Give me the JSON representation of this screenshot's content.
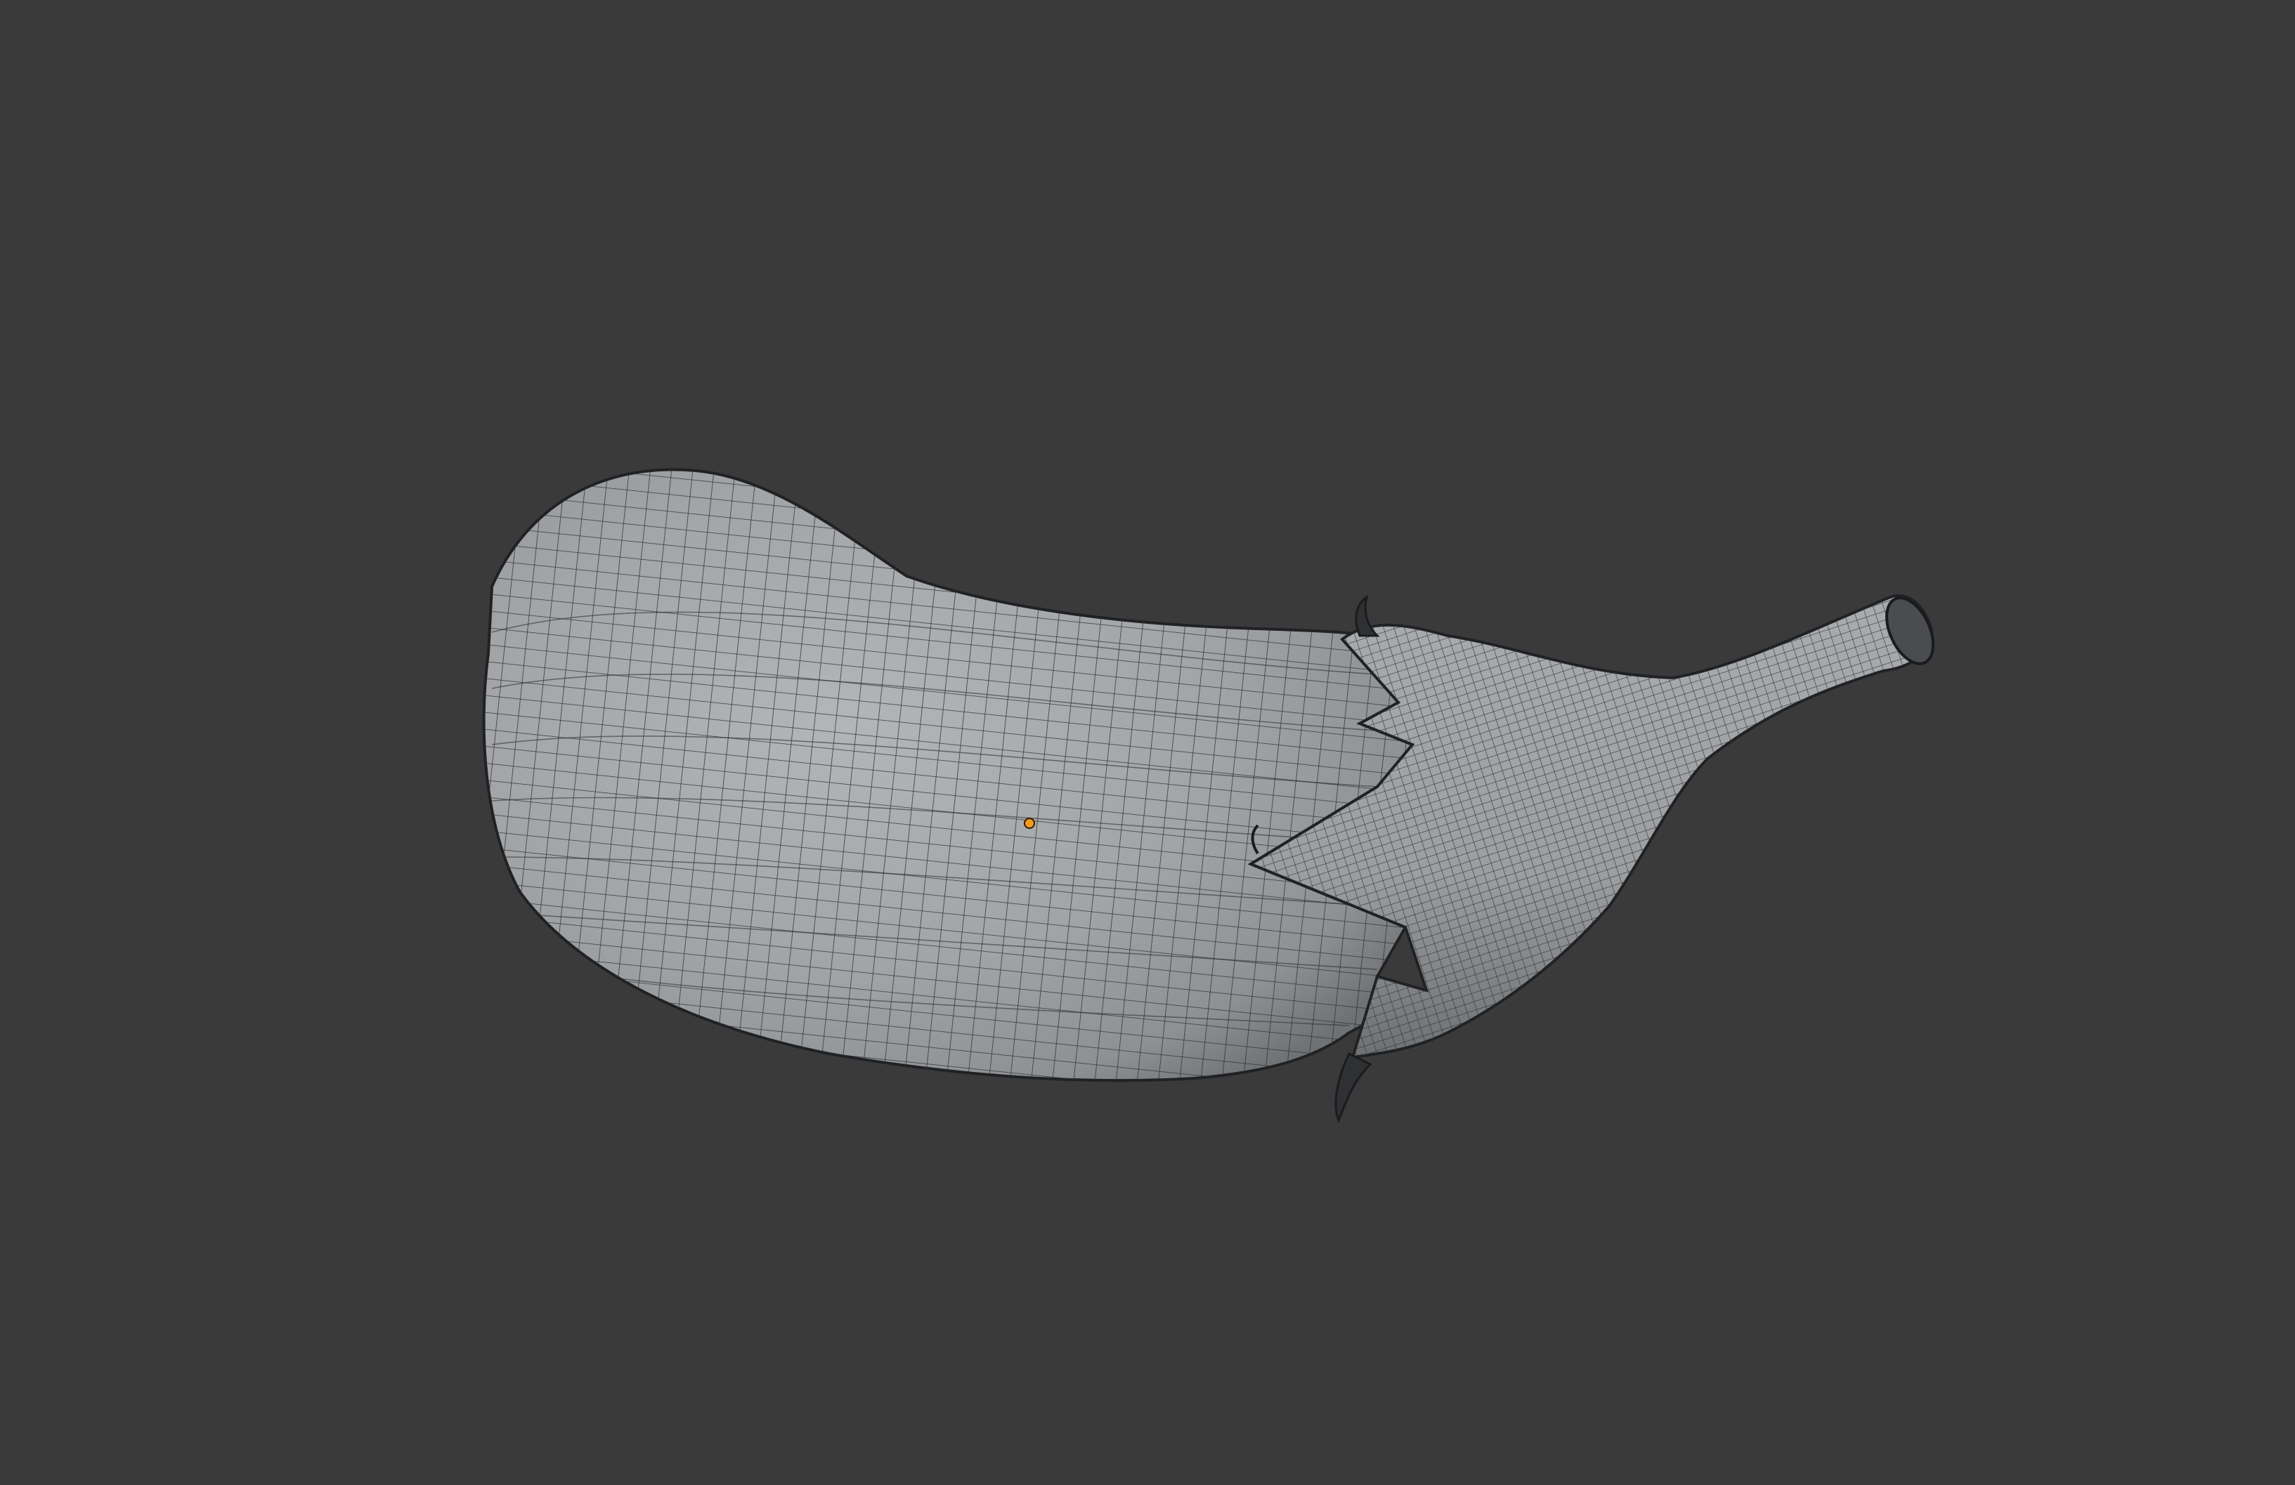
{
  "viewport": {
    "background": "#3a3a3a",
    "shading": "solid",
    "overlay": "wireframe",
    "object": "eggplant-mesh",
    "mesh_color": "#a3a5a7",
    "wire_color": "#2b2d30",
    "origin_color": "#f39a1f"
  }
}
